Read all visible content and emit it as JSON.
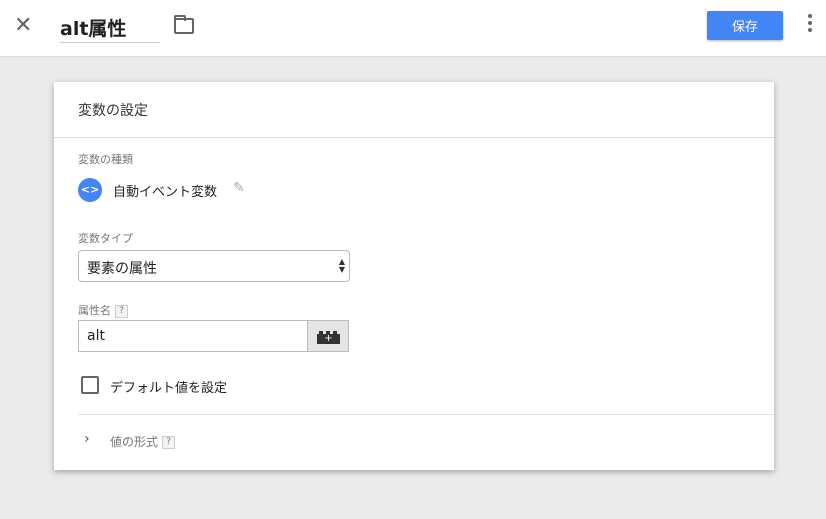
{
  "header": {
    "title": "alt属性",
    "save_label": "保存"
  },
  "card": {
    "title": "変数の設定",
    "type_section_label": "変数の種類",
    "type_icon": "<>",
    "type_name": "自動イベント変数",
    "var_type_label": "変数タイプ",
    "var_type_value": "要素の属性",
    "attr_label": "属性名",
    "help": "?",
    "attr_value": "alt",
    "default_label": "デフォルト値を設定",
    "default_checked": false,
    "format_label": "値の形式"
  }
}
